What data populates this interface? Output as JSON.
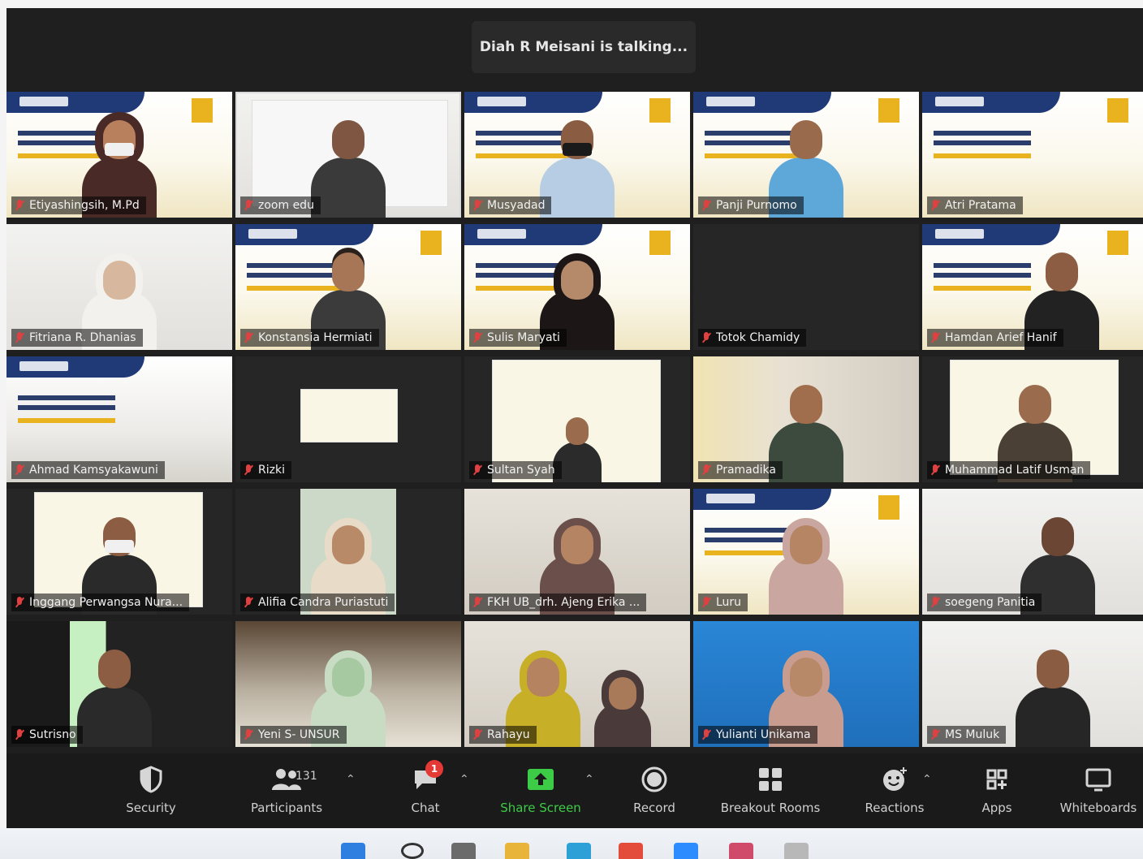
{
  "status": {
    "talking": "Diah R Meisani is talking..."
  },
  "participants": [
    {
      "name": "Etiyashingsih, M.Pd"
    },
    {
      "name": "zoom edu"
    },
    {
      "name": "Musyadad"
    },
    {
      "name": "Panji Purnomo"
    },
    {
      "name": "Atri Pratama"
    },
    {
      "name": "Fitriana R. Dhanias"
    },
    {
      "name": "Konstansia Hermiati"
    },
    {
      "name": "Sulis Maryati"
    },
    {
      "name": "Totok Chamidy"
    },
    {
      "name": "Hamdan Arief Hanif"
    },
    {
      "name": "Ahmad Kamsyakawuni"
    },
    {
      "name": "Rizki"
    },
    {
      "name": "Sultan Syah"
    },
    {
      "name": "Pramadika"
    },
    {
      "name": "Muhammad Latif Usman"
    },
    {
      "name": "Inggang Perwangsa Nura..."
    },
    {
      "name": "Alifia Candra Puriastuti"
    },
    {
      "name": "FKH UB_drh. Ajeng Erika ..."
    },
    {
      "name": "Luru"
    },
    {
      "name": "soegeng Panitia"
    },
    {
      "name": "Sutrisno"
    },
    {
      "name": "Yeni S- UNSUR"
    },
    {
      "name": "Rahayu"
    },
    {
      "name": "Yulianti Unikama"
    },
    {
      "name": "MS Muluk"
    }
  ],
  "toolbar": {
    "security": "Security",
    "participants": "Participants",
    "participants_count": "131",
    "chat": "Chat",
    "chat_badge": "1",
    "share_screen": "Share Screen",
    "record": "Record",
    "breakout_rooms": "Breakout Rooms",
    "reactions": "Reactions",
    "apps": "Apps",
    "whiteboards": "Whiteboards"
  },
  "colors": {
    "share_screen": "#3ccc46",
    "badge": "#e53935",
    "mute": "#e04040"
  },
  "icons": {
    "security": "shield-icon",
    "participants": "people-icon",
    "chat": "chat-icon",
    "share_screen": "share-arrow-icon",
    "record": "record-icon",
    "breakout_rooms": "grid-icon",
    "reactions": "smiley-icon",
    "apps": "apps-icon",
    "whiteboards": "whiteboard-icon"
  }
}
